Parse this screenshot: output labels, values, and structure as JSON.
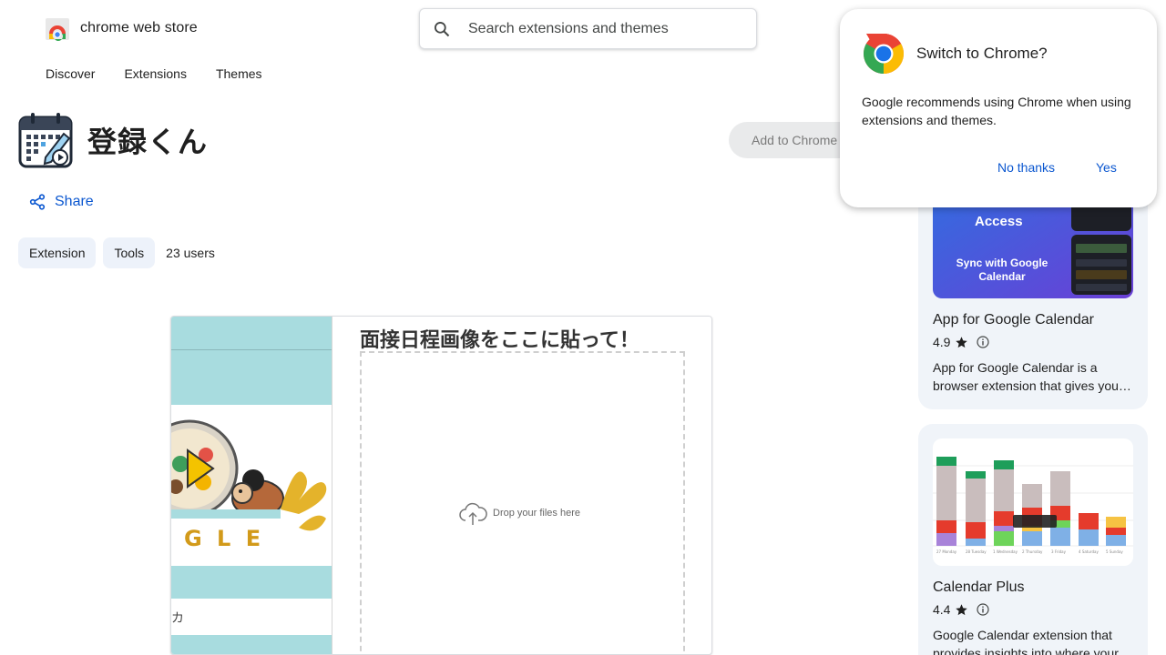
{
  "header": {
    "brand_name": "chrome web store",
    "search_placeholder": "Search extensions and themes",
    "nav": [
      "Discover",
      "Extensions",
      "Themes"
    ]
  },
  "extension": {
    "title": "登録くん",
    "add_button": "Add to Chrome",
    "share_label": "Share",
    "chips": [
      "Extension",
      "Tools"
    ],
    "users": "23 users"
  },
  "screenshot": {
    "heading": "面接日程画像をここに貼って！",
    "drop_label": "Drop your files here",
    "left_art_text": "G L E",
    "left_lower_text": "カ"
  },
  "popup": {
    "title": "Switch to Chrome?",
    "body": "Google recommends using Chrome when using extensions and themes.",
    "no_button": "No thanks",
    "yes_button": "Yes"
  },
  "related": [
    {
      "name": "App for Google Calendar",
      "rating": "4.9",
      "description": "App for Google Calendar is a browser extension that gives you…",
      "image_texts": {
        "access": "Access",
        "sync": "Sync with Google Calendar"
      }
    },
    {
      "name": "Calendar Plus",
      "rating": "4.4",
      "description": "Google Calendar extension that provides insights into where your..."
    }
  ],
  "colors": {
    "link_blue": "#0b57d0",
    "card_bg": "#f0f4f9",
    "chip_bg": "#edf2fa",
    "teal": "#a8dcdf"
  }
}
